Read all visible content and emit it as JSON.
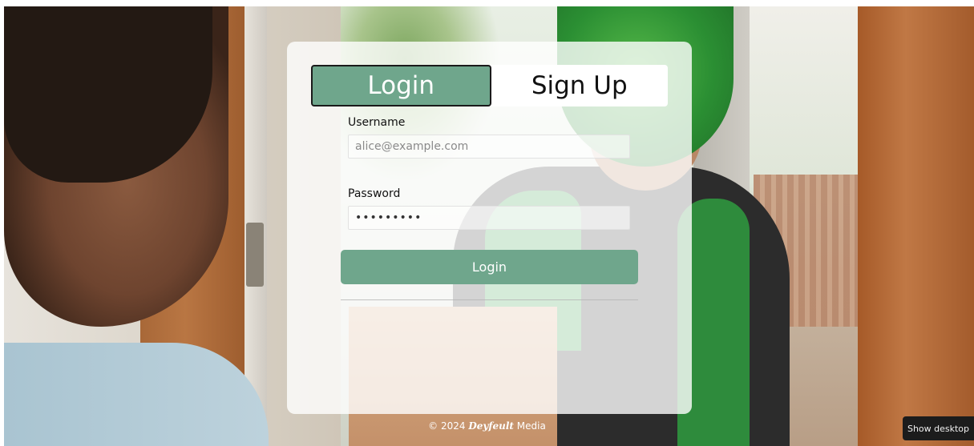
{
  "tabs": {
    "login_label": "Login",
    "signup_label": "Sign Up",
    "active": "login"
  },
  "form": {
    "username_label": "Username",
    "username_placeholder": "alice@example.com",
    "password_label": "Password",
    "password_value": "•••••••••",
    "submit_label": "Login"
  },
  "footer": {
    "prefix": "© 2024",
    "brand": "Deyfeult",
    "suffix": "Media"
  },
  "taskbar": {
    "show_desktop_label": "Show desktop"
  },
  "colors": {
    "accent": "#6fa68c",
    "card_background": "#ffffff",
    "taskbar": "#1c1c1c"
  }
}
